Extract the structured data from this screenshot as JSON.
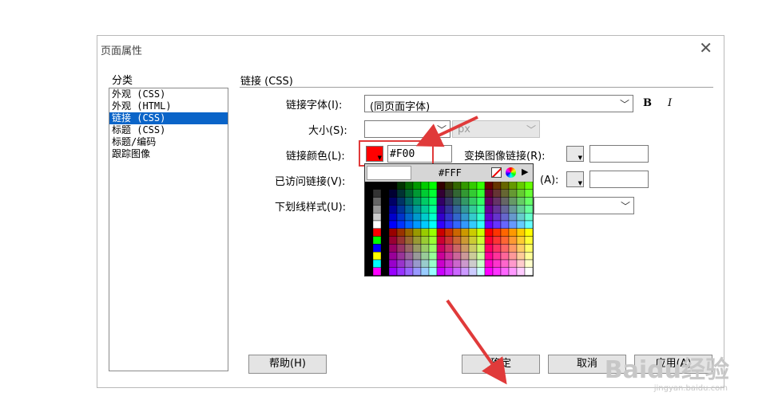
{
  "dialog": {
    "title": "页面属性",
    "close_glyph": "✕"
  },
  "categories": {
    "label": "分类",
    "items": [
      "外观 (CSS)",
      "外观 (HTML)",
      "链接 (CSS)",
      "标题 (CSS)",
      "标题/编码",
      "跟踪图像"
    ],
    "selected_index": 2
  },
  "section": {
    "title": "链接 (CSS)"
  },
  "form": {
    "link_font_label": "链接字体(I):",
    "link_font_value": "(同页面字体)",
    "bold_label": "B",
    "italic_label": "I",
    "size_label": "大小(S):",
    "size_unit": "px",
    "link_color_label": "链接颜色(L):",
    "link_color_value": "#F00",
    "link_color_swatch": "#ff0000",
    "rollover_label": "变换图像链接(R):",
    "visited_label": "已访问链接(V):",
    "active_label_tail": "(A):",
    "underline_label": "下划线样式(U):"
  },
  "picker": {
    "hex": "#FFF"
  },
  "buttons": {
    "help": "帮助(H)",
    "ok": "确定",
    "cancel": "取消",
    "apply": "应用(A)"
  },
  "watermark": {
    "main": "Baidu经验",
    "sub": "jingyan.baidu.com"
  },
  "colors": {
    "accent": "#0a64c8",
    "highlight": "#e03a3a"
  }
}
